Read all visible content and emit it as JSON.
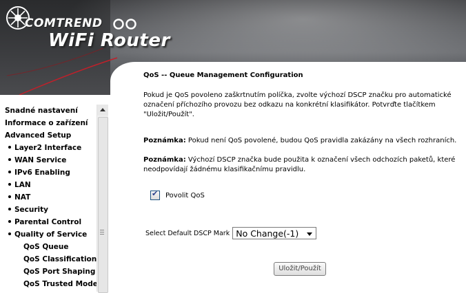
{
  "brand": {
    "company": "COMTREND",
    "product": "WiFi Router"
  },
  "menu": {
    "items": [
      {
        "label": "Snadné nastavení",
        "level": 0
      },
      {
        "label": "Informace o zařízení",
        "level": 0
      },
      {
        "label": "Advanced Setup",
        "level": 0
      },
      {
        "label": "Layer2 Interface",
        "level": 1
      },
      {
        "label": "WAN Service",
        "level": 1
      },
      {
        "label": "IPv6 Enabling",
        "level": 1
      },
      {
        "label": "LAN",
        "level": 1
      },
      {
        "label": "NAT",
        "level": 1
      },
      {
        "label": "Security",
        "level": 1
      },
      {
        "label": "Parental Control",
        "level": 1
      },
      {
        "label": "Quality of Service",
        "level": 1
      },
      {
        "label": "QoS Queue",
        "level": 2
      },
      {
        "label": "QoS Classification",
        "level": 2
      },
      {
        "label": "QoS Port Shaping",
        "level": 2
      },
      {
        "label": "QoS Trusted Mode",
        "level": 2
      }
    ]
  },
  "content": {
    "title": "QoS -- Queue Management Configuration",
    "intro": "Pokud je QoS povoleno zaškrtnutím políčka, zvolte výchozí DSCP značku pro automatické označení příchozího provozu bez odkazu na konkrétní klasifikátor. Potvrďte tlačítkem \"Uložit/Použít\".",
    "note1_label": "Poznámka:",
    "note1_text": " Pokud není QoS povolené, budou QoS pravidla zakázány na všech rozhraních.",
    "note2_label": "Poznámka:",
    "note2_text": " Výchozí DSCP značka bude použita k označení všech odchozích paketů, které neodpovídají žádnému klasifikačnímu pravidlu.",
    "enable_qos_label": "Povolit QoS",
    "enable_qos_checked": true,
    "dscp_label": "Select Default DSCP Mark",
    "dscp_value": "No Change(-1)",
    "submit_label": "Uložit/Použít"
  }
}
